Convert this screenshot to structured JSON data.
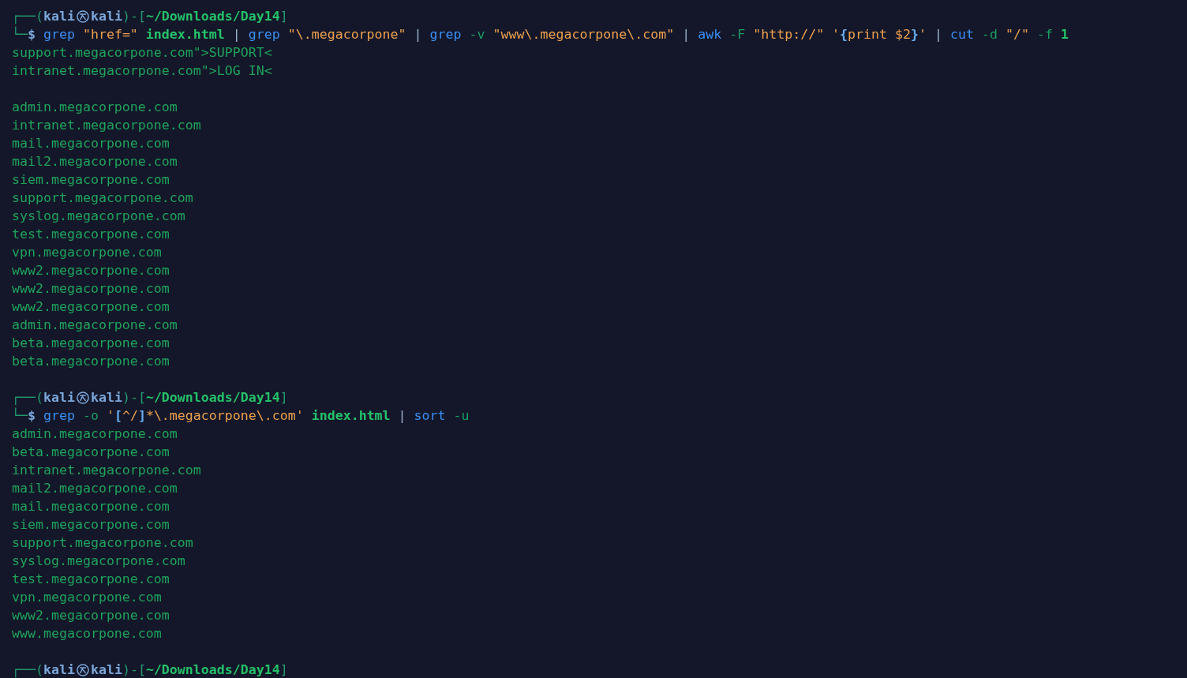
{
  "terminal": {
    "blocks": [
      {
        "prompt": [
          {
            "kind": "frame",
            "text": "┌──("
          },
          {
            "kind": "user",
            "text": "kali"
          },
          {
            "kind": "symbol"
          },
          {
            "kind": "host",
            "text": "kali"
          },
          {
            "kind": "frame",
            "text": ")-["
          },
          {
            "kind": "path",
            "text": "~/Downloads/Day14"
          },
          {
            "kind": "frame",
            "text": "]"
          }
        ],
        "command": [
          {
            "kind": "frame",
            "text": "└─"
          },
          {
            "kind": "dollar",
            "text": "$"
          },
          {
            "kind": "command",
            "text": " grep"
          },
          {
            "kind": "string",
            "text": " \"href=\""
          },
          {
            "kind": "argument",
            "text": " index.html"
          },
          {
            "kind": "pipe",
            "text": " |"
          },
          {
            "kind": "command",
            "text": " grep"
          },
          {
            "kind": "string",
            "text": " \"\\.megacorpone\""
          },
          {
            "kind": "pipe",
            "text": " |"
          },
          {
            "kind": "command",
            "text": " grep"
          },
          {
            "kind": "option",
            "text": " -v"
          },
          {
            "kind": "string",
            "text": " \"www\\.megacorpone\\.com\""
          },
          {
            "kind": "pipe",
            "text": " |"
          },
          {
            "kind": "command",
            "text": " awk"
          },
          {
            "kind": "option",
            "text": " -F"
          },
          {
            "kind": "string",
            "text": " \"http://\""
          },
          {
            "kind": "string",
            "text": " '"
          },
          {
            "kind": "brace",
            "text": "{"
          },
          {
            "kind": "string",
            "text": "print $2"
          },
          {
            "kind": "brace",
            "text": "}"
          },
          {
            "kind": "string",
            "text": "'"
          },
          {
            "kind": "pipe",
            "text": " |"
          },
          {
            "kind": "command",
            "text": " cut"
          },
          {
            "kind": "option",
            "text": " -d"
          },
          {
            "kind": "string",
            "text": " \"/\""
          },
          {
            "kind": "option",
            "text": " -f"
          },
          {
            "kind": "argument",
            "text": " 1"
          }
        ],
        "output": [
          [
            "support.megacorpone.com\">SUPPORT<",
            "intranet.megacorpone.com\">LOG IN<"
          ],
          [
            "admin.megacorpone.com",
            "intranet.megacorpone.com",
            "mail.megacorpone.com",
            "mail2.megacorpone.com",
            "siem.megacorpone.com",
            "support.megacorpone.com",
            "syslog.megacorpone.com",
            "test.megacorpone.com",
            "vpn.megacorpone.com",
            "www2.megacorpone.com",
            "www2.megacorpone.com",
            "www2.megacorpone.com",
            "admin.megacorpone.com",
            "beta.megacorpone.com",
            "beta.megacorpone.com"
          ]
        ]
      },
      {
        "prompt": [
          {
            "kind": "frame",
            "text": "┌──("
          },
          {
            "kind": "user",
            "text": "kali"
          },
          {
            "kind": "symbol"
          },
          {
            "kind": "host",
            "text": "kali"
          },
          {
            "kind": "frame",
            "text": ")-["
          },
          {
            "kind": "path",
            "text": "~/Downloads/Day14"
          },
          {
            "kind": "frame",
            "text": "]"
          }
        ],
        "command": [
          {
            "kind": "frame",
            "text": "└─"
          },
          {
            "kind": "dollar",
            "text": "$"
          },
          {
            "kind": "command",
            "text": " grep"
          },
          {
            "kind": "option",
            "text": " -o"
          },
          {
            "kind": "string",
            "text": " '"
          },
          {
            "kind": "brace",
            "text": "["
          },
          {
            "kind": "string",
            "text": "^/"
          },
          {
            "kind": "brace",
            "text": "]"
          },
          {
            "kind": "string",
            "text": "*\\.megacorpone\\.com'"
          },
          {
            "kind": "argument",
            "text": " index.html"
          },
          {
            "kind": "pipe",
            "text": " |"
          },
          {
            "kind": "command",
            "text": " sort"
          },
          {
            "kind": "option",
            "text": " -u"
          }
        ],
        "output": [
          [
            "admin.megacorpone.com",
            "beta.megacorpone.com",
            "intranet.megacorpone.com",
            "mail2.megacorpone.com",
            "mail.megacorpone.com",
            "siem.megacorpone.com",
            "support.megacorpone.com",
            "syslog.megacorpone.com",
            "test.megacorpone.com",
            "vpn.megacorpone.com",
            "www2.megacorpone.com",
            "www.megacorpone.com"
          ]
        ]
      },
      {
        "prompt": [
          {
            "kind": "frame",
            "text": "┌──("
          },
          {
            "kind": "user",
            "text": "kali"
          },
          {
            "kind": "symbol"
          },
          {
            "kind": "host",
            "text": "kali"
          },
          {
            "kind": "frame",
            "text": ")-["
          },
          {
            "kind": "path",
            "text": "~/Downloads/Day14"
          },
          {
            "kind": "frame",
            "text": "]"
          }
        ]
      }
    ]
  }
}
